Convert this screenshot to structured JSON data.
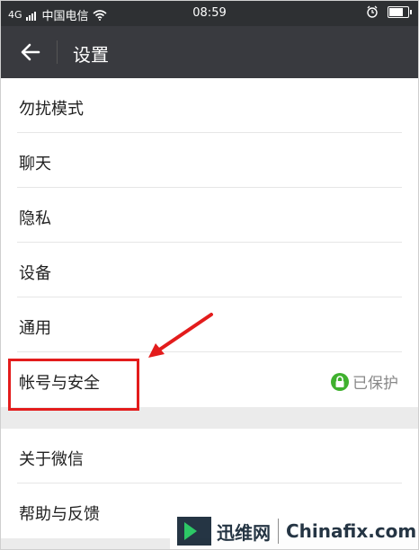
{
  "status_bar": {
    "signal_text": "4G",
    "carrier": "中国电信",
    "time": "08:59",
    "battery_level": 0.7
  },
  "nav": {
    "title": "设置",
    "back_icon": "arrow-left-icon"
  },
  "settings": {
    "items": [
      {
        "label": "勿扰模式"
      },
      {
        "label": "聊天"
      },
      {
        "label": "隐私"
      },
      {
        "label": "设备"
      },
      {
        "label": "通用"
      },
      {
        "label": "帐号与安全",
        "status": "已保护"
      }
    ],
    "items2": [
      {
        "label": "关于微信"
      },
      {
        "label": "帮助与反馈"
      }
    ]
  },
  "watermark": {
    "cn": "迅维网",
    "en": "Chinafix.com"
  },
  "colors": {
    "nav_bg": "#393a3f",
    "status_bg": "#2e3033",
    "accent_green": "#3fb12e",
    "highlight_red": "#e31c1c"
  }
}
